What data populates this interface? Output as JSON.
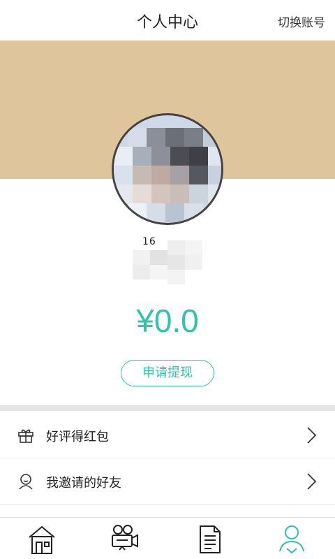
{
  "header": {
    "title": "个人中心",
    "switch_account": "切换账号"
  },
  "profile": {
    "username": "16"
  },
  "wallet": {
    "balance": "¥0.0",
    "withdraw_label": "申请提现"
  },
  "menu": [
    {
      "label": "好评得红包",
      "icon": "gift-icon"
    },
    {
      "label": "我邀请的好友",
      "icon": "friend-icon"
    }
  ],
  "tabbar": {
    "items": [
      {
        "icon": "home-icon"
      },
      {
        "icon": "movie-camera-icon"
      },
      {
        "icon": "document-icon"
      },
      {
        "icon": "profile-icon"
      }
    ],
    "active_index": 3
  },
  "colors": {
    "accent": "#2ec4a8",
    "banner": "#dec59b"
  }
}
